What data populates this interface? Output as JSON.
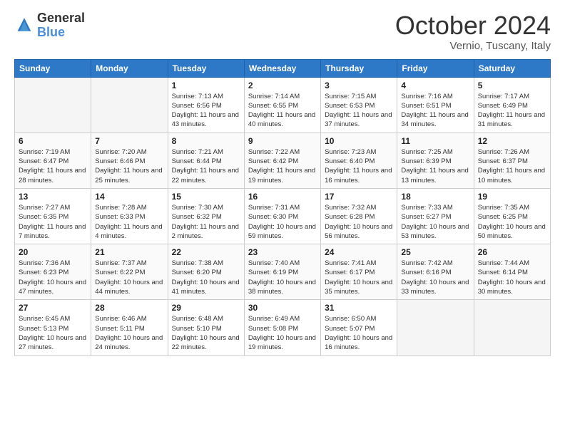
{
  "header": {
    "logo_line1": "General",
    "logo_line2": "Blue",
    "month": "October 2024",
    "location": "Vernio, Tuscany, Italy"
  },
  "weekdays": [
    "Sunday",
    "Monday",
    "Tuesday",
    "Wednesday",
    "Thursday",
    "Friday",
    "Saturday"
  ],
  "weeks": [
    [
      {
        "day": "",
        "empty": true
      },
      {
        "day": "",
        "empty": true
      },
      {
        "day": "1",
        "info": "Sunrise: 7:13 AM\nSunset: 6:56 PM\nDaylight: 11 hours and 43 minutes."
      },
      {
        "day": "2",
        "info": "Sunrise: 7:14 AM\nSunset: 6:55 PM\nDaylight: 11 hours and 40 minutes."
      },
      {
        "day": "3",
        "info": "Sunrise: 7:15 AM\nSunset: 6:53 PM\nDaylight: 11 hours and 37 minutes."
      },
      {
        "day": "4",
        "info": "Sunrise: 7:16 AM\nSunset: 6:51 PM\nDaylight: 11 hours and 34 minutes."
      },
      {
        "day": "5",
        "info": "Sunrise: 7:17 AM\nSunset: 6:49 PM\nDaylight: 11 hours and 31 minutes."
      }
    ],
    [
      {
        "day": "6",
        "info": "Sunrise: 7:19 AM\nSunset: 6:47 PM\nDaylight: 11 hours and 28 minutes."
      },
      {
        "day": "7",
        "info": "Sunrise: 7:20 AM\nSunset: 6:46 PM\nDaylight: 11 hours and 25 minutes."
      },
      {
        "day": "8",
        "info": "Sunrise: 7:21 AM\nSunset: 6:44 PM\nDaylight: 11 hours and 22 minutes."
      },
      {
        "day": "9",
        "info": "Sunrise: 7:22 AM\nSunset: 6:42 PM\nDaylight: 11 hours and 19 minutes."
      },
      {
        "day": "10",
        "info": "Sunrise: 7:23 AM\nSunset: 6:40 PM\nDaylight: 11 hours and 16 minutes."
      },
      {
        "day": "11",
        "info": "Sunrise: 7:25 AM\nSunset: 6:39 PM\nDaylight: 11 hours and 13 minutes."
      },
      {
        "day": "12",
        "info": "Sunrise: 7:26 AM\nSunset: 6:37 PM\nDaylight: 11 hours and 10 minutes."
      }
    ],
    [
      {
        "day": "13",
        "info": "Sunrise: 7:27 AM\nSunset: 6:35 PM\nDaylight: 11 hours and 7 minutes."
      },
      {
        "day": "14",
        "info": "Sunrise: 7:28 AM\nSunset: 6:33 PM\nDaylight: 11 hours and 4 minutes."
      },
      {
        "day": "15",
        "info": "Sunrise: 7:30 AM\nSunset: 6:32 PM\nDaylight: 11 hours and 2 minutes."
      },
      {
        "day": "16",
        "info": "Sunrise: 7:31 AM\nSunset: 6:30 PM\nDaylight: 10 hours and 59 minutes."
      },
      {
        "day": "17",
        "info": "Sunrise: 7:32 AM\nSunset: 6:28 PM\nDaylight: 10 hours and 56 minutes."
      },
      {
        "day": "18",
        "info": "Sunrise: 7:33 AM\nSunset: 6:27 PM\nDaylight: 10 hours and 53 minutes."
      },
      {
        "day": "19",
        "info": "Sunrise: 7:35 AM\nSunset: 6:25 PM\nDaylight: 10 hours and 50 minutes."
      }
    ],
    [
      {
        "day": "20",
        "info": "Sunrise: 7:36 AM\nSunset: 6:23 PM\nDaylight: 10 hours and 47 minutes."
      },
      {
        "day": "21",
        "info": "Sunrise: 7:37 AM\nSunset: 6:22 PM\nDaylight: 10 hours and 44 minutes."
      },
      {
        "day": "22",
        "info": "Sunrise: 7:38 AM\nSunset: 6:20 PM\nDaylight: 10 hours and 41 minutes."
      },
      {
        "day": "23",
        "info": "Sunrise: 7:40 AM\nSunset: 6:19 PM\nDaylight: 10 hours and 38 minutes."
      },
      {
        "day": "24",
        "info": "Sunrise: 7:41 AM\nSunset: 6:17 PM\nDaylight: 10 hours and 35 minutes."
      },
      {
        "day": "25",
        "info": "Sunrise: 7:42 AM\nSunset: 6:16 PM\nDaylight: 10 hours and 33 minutes."
      },
      {
        "day": "26",
        "info": "Sunrise: 7:44 AM\nSunset: 6:14 PM\nDaylight: 10 hours and 30 minutes."
      }
    ],
    [
      {
        "day": "27",
        "info": "Sunrise: 6:45 AM\nSunset: 5:13 PM\nDaylight: 10 hours and 27 minutes."
      },
      {
        "day": "28",
        "info": "Sunrise: 6:46 AM\nSunset: 5:11 PM\nDaylight: 10 hours and 24 minutes."
      },
      {
        "day": "29",
        "info": "Sunrise: 6:48 AM\nSunset: 5:10 PM\nDaylight: 10 hours and 22 minutes."
      },
      {
        "day": "30",
        "info": "Sunrise: 6:49 AM\nSunset: 5:08 PM\nDaylight: 10 hours and 19 minutes."
      },
      {
        "day": "31",
        "info": "Sunrise: 6:50 AM\nSunset: 5:07 PM\nDaylight: 10 hours and 16 minutes."
      },
      {
        "day": "",
        "empty": true
      },
      {
        "day": "",
        "empty": true
      }
    ]
  ]
}
